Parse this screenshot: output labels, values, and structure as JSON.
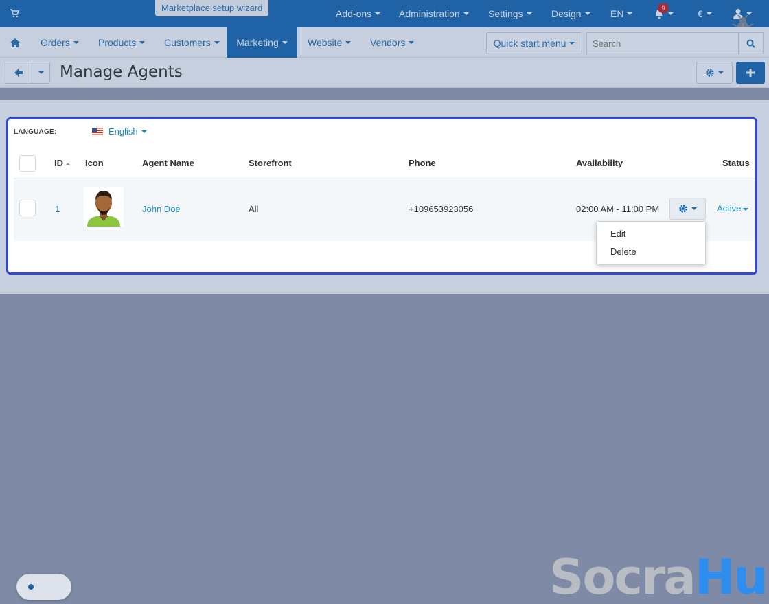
{
  "topbar": {
    "wizard_label": "Marketplace setup wizard",
    "menu": [
      "Add-ons",
      "Administration",
      "Settings",
      "Design",
      "EN"
    ],
    "notifications_count": "9",
    "currency": "€"
  },
  "nav": {
    "items": [
      "Orders",
      "Products",
      "Customers",
      "Marketing",
      "Website",
      "Vendors"
    ],
    "active": "Marketing",
    "quick_start": "Quick start menu",
    "search_placeholder": "Search"
  },
  "page": {
    "title": "Manage Agents"
  },
  "language": {
    "label": "LANGUAGE:",
    "value": "English"
  },
  "table": {
    "columns": [
      "ID",
      "Icon",
      "Agent Name",
      "Storefront",
      "Phone",
      "Availability",
      "Status"
    ],
    "rows": [
      {
        "id": "1",
        "name": "John Doe",
        "storefront": "All",
        "phone": "+109653923056",
        "availability": "02:00 AM - 11:00 PM",
        "status": "Active"
      }
    ]
  },
  "row_menu": {
    "items": [
      "Edit",
      "Delete"
    ]
  },
  "brand": {
    "part1": "Socra",
    "part2": "Hub"
  },
  "colors": {
    "primary": "#1f63a6",
    "link": "#1a8bc4",
    "highlight_border": "#3447d6"
  }
}
